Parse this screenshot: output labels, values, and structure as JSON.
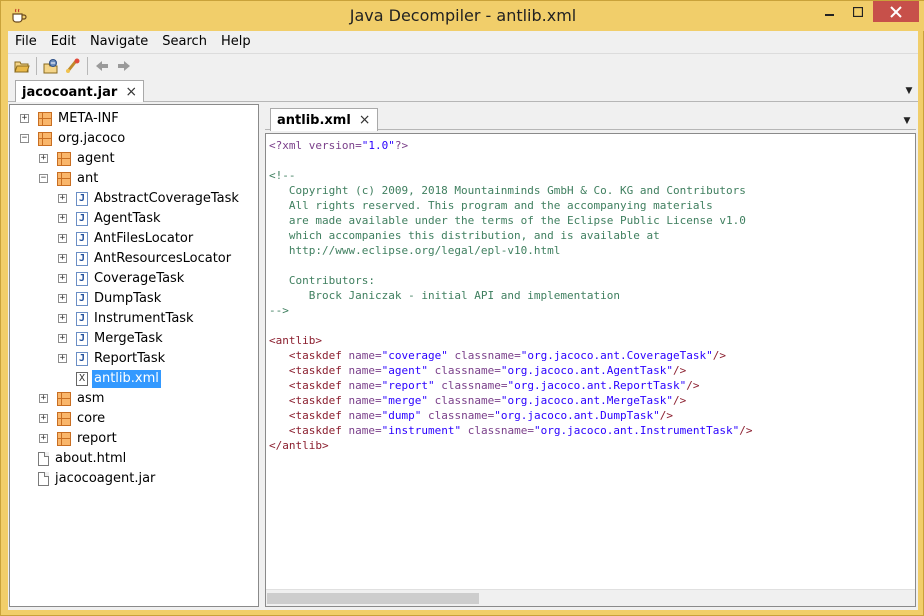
{
  "window": {
    "title": "Java Decompiler - antlib.xml"
  },
  "colors": {
    "frame": "#f1ce6a",
    "close_button": "#c7504a",
    "selection": "#3399ff"
  },
  "menu": [
    "File",
    "Edit",
    "Navigate",
    "Search",
    "Help"
  ],
  "toolbar": {
    "buttons": [
      "open-file-icon",
      "open-type-icon",
      "open-type-hierarchy-icon",
      "back-icon",
      "forward-icon"
    ]
  },
  "outer_tab": {
    "label": "jacocoant.jar",
    "close": "×"
  },
  "tree": [
    {
      "label": "META-INF",
      "icon": "package-icon",
      "expander": "+"
    },
    {
      "label": "org.jacoco",
      "icon": "package-icon",
      "expander": "−"
    },
    {
      "label": "agent",
      "icon": "package-icon",
      "expander": "+"
    },
    {
      "label": "ant",
      "icon": "package-icon",
      "expander": "−"
    },
    {
      "label": "AbstractCoverageTask",
      "icon": "java-class-icon",
      "expander": "+"
    },
    {
      "label": "AgentTask",
      "icon": "java-class-icon",
      "expander": "+"
    },
    {
      "label": "AntFilesLocator",
      "icon": "java-class-icon",
      "expander": "+"
    },
    {
      "label": "AntResourcesLocator",
      "icon": "java-class-icon",
      "expander": "+"
    },
    {
      "label": "CoverageTask",
      "icon": "java-class-icon",
      "expander": "+"
    },
    {
      "label": "DumpTask",
      "icon": "java-class-icon",
      "expander": "+"
    },
    {
      "label": "InstrumentTask",
      "icon": "java-class-icon",
      "expander": "+"
    },
    {
      "label": "MergeTask",
      "icon": "java-class-icon",
      "expander": "+"
    },
    {
      "label": "ReportTask",
      "icon": "java-class-icon",
      "expander": "+"
    },
    {
      "label": "antlib.xml",
      "icon": "xml-file-icon",
      "selected": true
    },
    {
      "label": "asm",
      "icon": "package-icon",
      "expander": "+"
    },
    {
      "label": "core",
      "icon": "package-icon",
      "expander": "+"
    },
    {
      "label": "report",
      "icon": "package-icon",
      "expander": "+"
    },
    {
      "label": "about.html",
      "icon": "file-icon"
    },
    {
      "label": "jacocoagent.jar",
      "icon": "file-icon"
    }
  ],
  "editor_tab": {
    "label": "antlib.xml",
    "close": "×"
  },
  "code_lines": [
    [
      [
        "pi",
        "<?xml "
      ],
      [
        "attr",
        "version="
      ],
      [
        "val",
        "\"1.0\""
      ],
      [
        "pi",
        "?>"
      ]
    ],
    [],
    [
      [
        "comment",
        "<!--"
      ]
    ],
    [
      [
        "comment",
        "   Copyright (c) 2009, 2018 Mountainminds GmbH & Co. KG and Contributors"
      ]
    ],
    [
      [
        "comment",
        "   All rights reserved. This program and the accompanying materials"
      ]
    ],
    [
      [
        "comment",
        "   are made available under the terms of the Eclipse Public License v1.0"
      ]
    ],
    [
      [
        "comment",
        "   which accompanies this distribution, and is available at"
      ]
    ],
    [
      [
        "comment",
        "   http://www.eclipse.org/legal/epl-v10.html"
      ]
    ],
    [],
    [
      [
        "comment",
        "   Contributors:"
      ]
    ],
    [
      [
        "comment",
        "      Brock Janiczak - initial API and implementation"
      ]
    ],
    [
      [
        "comment",
        "-->"
      ]
    ],
    [],
    [
      [
        "tag",
        "<antlib>"
      ]
    ],
    [
      [
        "tag",
        "   <taskdef "
      ],
      [
        "attr",
        "name="
      ],
      [
        "val",
        "\"coverage\""
      ],
      [
        "attr",
        " classname="
      ],
      [
        "val",
        "\"org.jacoco.ant.CoverageTask\""
      ],
      [
        "tag",
        "/>"
      ]
    ],
    [
      [
        "tag",
        "   <taskdef "
      ],
      [
        "attr",
        "name="
      ],
      [
        "val",
        "\"agent\""
      ],
      [
        "attr",
        " classname="
      ],
      [
        "val",
        "\"org.jacoco.ant.AgentTask\""
      ],
      [
        "tag",
        "/>"
      ]
    ],
    [
      [
        "tag",
        "   <taskdef "
      ],
      [
        "attr",
        "name="
      ],
      [
        "val",
        "\"report\""
      ],
      [
        "attr",
        " classname="
      ],
      [
        "val",
        "\"org.jacoco.ant.ReportTask\""
      ],
      [
        "tag",
        "/>"
      ]
    ],
    [
      [
        "tag",
        "   <taskdef "
      ],
      [
        "attr",
        "name="
      ],
      [
        "val",
        "\"merge\""
      ],
      [
        "attr",
        " classname="
      ],
      [
        "val",
        "\"org.jacoco.ant.MergeTask\""
      ],
      [
        "tag",
        "/>"
      ]
    ],
    [
      [
        "tag",
        "   <taskdef "
      ],
      [
        "attr",
        "name="
      ],
      [
        "val",
        "\"dump\""
      ],
      [
        "attr",
        " classname="
      ],
      [
        "val",
        "\"org.jacoco.ant.DumpTask\""
      ],
      [
        "tag",
        "/>"
      ]
    ],
    [
      [
        "tag",
        "   <taskdef "
      ],
      [
        "attr",
        "name="
      ],
      [
        "val",
        "\"instrument\""
      ],
      [
        "attr",
        " classname="
      ],
      [
        "val",
        "\"org.jacoco.ant.InstrumentTask\""
      ],
      [
        "tag",
        "/>"
      ]
    ],
    [
      [
        "tag",
        "</antlib>"
      ]
    ]
  ]
}
